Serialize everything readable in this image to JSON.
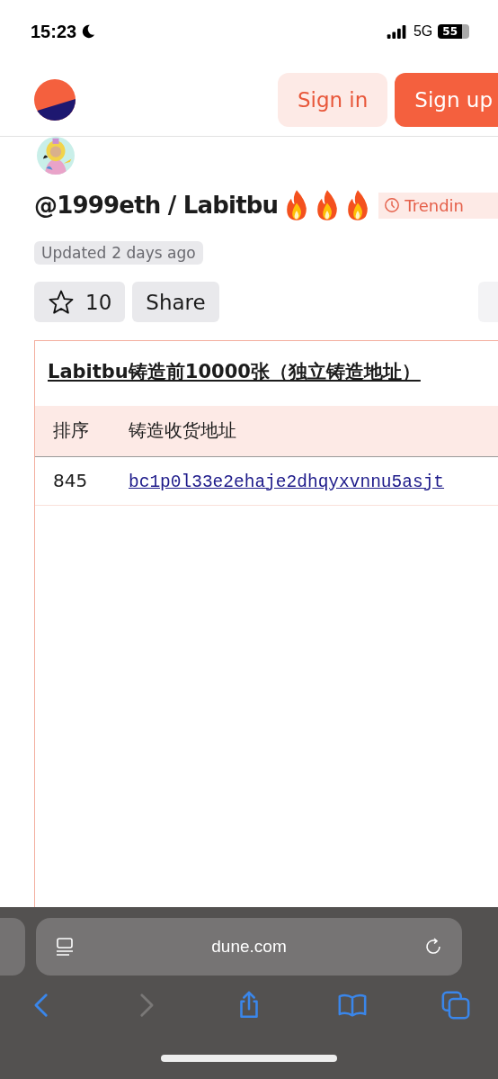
{
  "status_bar": {
    "time": "15:23",
    "network": "5G",
    "battery": "55"
  },
  "header": {
    "buttons": [
      {
        "label": "Sign in",
        "kind": "secondary"
      },
      {
        "label": "Sign up",
        "kind": "primary"
      }
    ]
  },
  "dashboard": {
    "title": "@1999eth / Labitbu",
    "badge": "Trendin",
    "updated_label": "Updated",
    "updated_value": "2 days ago",
    "star_count": "10",
    "share": "Share"
  },
  "table": {
    "title": "Labitbu铸造前10000张（独立铸造地址）",
    "columns": [
      "排序",
      "铸造收货地址"
    ],
    "rows": [
      [
        "845",
        "bc1p0l33e2ehaje2dhqyxvnnu5asjt"
      ]
    ]
  },
  "browser": {
    "url": "dune.com",
    "nav": [
      {
        "kind": "back",
        "disabled": false
      },
      {
        "kind": "forward",
        "disabled": true
      },
      {
        "kind": "share",
        "disabled": false
      },
      {
        "kind": "bookmarks",
        "disabled": false
      },
      {
        "kind": "tabs",
        "disabled": false
      }
    ]
  }
}
